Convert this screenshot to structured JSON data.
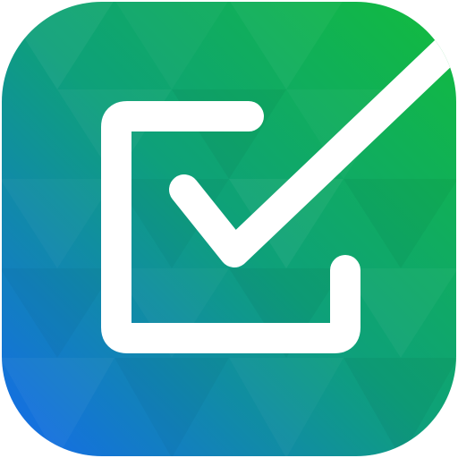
{
  "app_icon": {
    "icon_name": "checkbox-check-icon",
    "colors": {
      "gradient_top_right": "#12BC3C",
      "gradient_mid": "#0EA07A",
      "gradient_bottom_left": "#1569EE",
      "glyph": "#FFFFFF"
    }
  }
}
